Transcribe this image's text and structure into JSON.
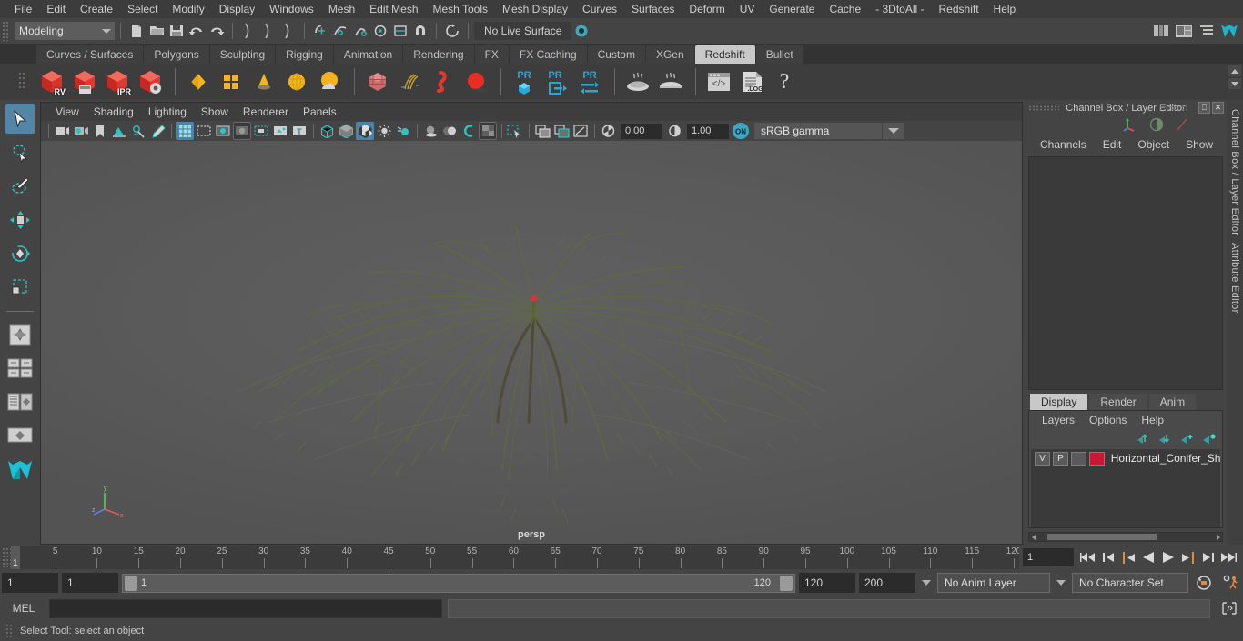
{
  "app": {
    "title": "Autodesk Maya",
    "accent": "#5285a6",
    "shelf_active_color": "#c8c8c8",
    "layer_color": "#c81832"
  },
  "menubar": {
    "items": [
      {
        "label": "File"
      },
      {
        "label": "Edit"
      },
      {
        "label": "Create"
      },
      {
        "label": "Select"
      },
      {
        "label": "Modify"
      },
      {
        "label": "Display"
      },
      {
        "label": "Windows"
      },
      {
        "label": "Mesh"
      },
      {
        "label": "Edit Mesh"
      },
      {
        "label": "Mesh Tools"
      },
      {
        "label": "Mesh Display"
      },
      {
        "label": "Curves"
      },
      {
        "label": "Surfaces"
      },
      {
        "label": "Deform"
      },
      {
        "label": "UV"
      },
      {
        "label": "Generate"
      },
      {
        "label": "Cache"
      },
      {
        "label": "- 3DtoAll -"
      },
      {
        "label": "Redshift"
      },
      {
        "label": "Help"
      }
    ]
  },
  "statusline": {
    "mode": "Modeling",
    "live_surface": "No Live Surface",
    "icons": [
      "new-scene-icon",
      "open-scene-icon",
      "save-scene-icon",
      "undo-icon",
      "redo-icon",
      "select-by-hierarchy-icon",
      "select-by-object-icon",
      "select-by-component-icon",
      "snap-grid-icon",
      "snap-curve-icon",
      "snap-point-icon",
      "snap-projected-icon",
      "snap-view-plane-icon",
      "construction-history-icon",
      "render-view-icon",
      "render-sequence-icon",
      "ipr-render-icon",
      "render-settings-icon",
      "hypershade-icon",
      "lightfog-icon",
      "outliner-icon",
      "node-editor-icon"
    ]
  },
  "shelf": {
    "tabs": [
      {
        "label": "Curves / Surfaces",
        "active": false
      },
      {
        "label": "Polygons",
        "active": false
      },
      {
        "label": "Sculpting",
        "active": false
      },
      {
        "label": "Rigging",
        "active": false
      },
      {
        "label": "Animation",
        "active": false
      },
      {
        "label": "Rendering",
        "active": false
      },
      {
        "label": "FX",
        "active": false
      },
      {
        "label": "FX Caching",
        "active": false
      },
      {
        "label": "Custom",
        "active": false
      },
      {
        "label": "XGen",
        "active": false
      },
      {
        "label": "Redshift",
        "active": true
      },
      {
        "label": "Bullet",
        "active": false
      }
    ],
    "buttons": [
      {
        "name": "redshift-render-view-icon",
        "label": "RV"
      },
      {
        "name": "redshift-render-sequence-icon",
        "label": ""
      },
      {
        "name": "redshift-ipr-icon",
        "label": "IPR"
      },
      {
        "name": "redshift-render-settings-icon",
        "label": ""
      },
      {
        "name": "redshift-area-light-icon",
        "label": ""
      },
      {
        "name": "redshift-portal-light-icon",
        "label": ""
      },
      {
        "name": "redshift-ies-light-icon",
        "label": ""
      },
      {
        "name": "redshift-dome-light-icon",
        "label": ""
      },
      {
        "name": "redshift-physical-sun-icon",
        "label": ""
      },
      {
        "name": "redshift-proxy-icon",
        "label": ""
      },
      {
        "name": "redshift-hair-icon",
        "label": ""
      },
      {
        "name": "redshift-volume-icon",
        "label": ""
      },
      {
        "name": "redshift-sphere-icon",
        "label": ""
      },
      {
        "name": "redshift-pr-object-icon",
        "label": "PR"
      },
      {
        "name": "redshift-pr-export-icon",
        "label": "PR"
      },
      {
        "name": "redshift-pr-transfer-icon",
        "label": "PR"
      },
      {
        "name": "redshift-bake-icon",
        "label": ""
      },
      {
        "name": "redshift-bake-set-icon",
        "label": ""
      },
      {
        "name": "redshift-script-editor-icon",
        "label": ""
      },
      {
        "name": "redshift-log-icon",
        "label": ".LOG"
      },
      {
        "name": "redshift-help-icon",
        "label": "?"
      }
    ]
  },
  "toolbox": {
    "items": [
      {
        "name": "select-tool",
        "selected": true
      },
      {
        "name": "lasso-select-tool",
        "selected": false
      },
      {
        "name": "paint-select-tool",
        "selected": false
      },
      {
        "name": "move-tool",
        "selected": false
      },
      {
        "name": "rotate-tool",
        "selected": false
      },
      {
        "name": "scale-tool",
        "selected": false
      },
      {
        "name": "last-tool-used",
        "selected": false
      },
      {
        "name": "four-view-layout",
        "selected": false
      },
      {
        "name": "persp-outliner-layout",
        "selected": false
      },
      {
        "name": "outliner-persp-layout",
        "selected": false
      },
      {
        "name": "single-persp-layout",
        "selected": false
      },
      {
        "name": "maya-logo",
        "selected": false
      }
    ]
  },
  "viewport": {
    "menus": [
      {
        "label": "View"
      },
      {
        "label": "Shading"
      },
      {
        "label": "Lighting"
      },
      {
        "label": "Show"
      },
      {
        "label": "Renderer"
      },
      {
        "label": "Panels"
      }
    ],
    "toolbar": {
      "exposure": "0.00",
      "gamma": "1.00",
      "color_management_toggle": "ON",
      "color_profile": "sRGB gamma",
      "icons": [
        "select-camera-icon",
        "camera-attributes-icon",
        "bookmark-icon",
        "image-plane-icon",
        "2d-pan-zoom-icon",
        "grease-pencil-icon",
        "grid-toggle-icon",
        "film-gate-icon",
        "resolution-gate-icon",
        "gate-mask-icon",
        "film-origin-icon",
        "safe-action-icon",
        "safe-title-icon",
        "wireframe-icon",
        "smooth-shade-all-icon",
        "smooth-shade-selected-icon",
        "flat-shade-icon",
        "wireframe-on-shaded-icon",
        "xray-icon",
        "xray-joints-icon",
        "default-lighting-icon",
        "all-lights-icon",
        "shadows-icon",
        "screen-space-ao-icon",
        "motion-blur-icon",
        "multisample-icon",
        "isolate-select-icon",
        "render-icon",
        "ipr-icon",
        "render-settings-icon"
      ]
    },
    "camera_label": "persp",
    "axis": {
      "x": "x",
      "y": "y",
      "z": "z"
    }
  },
  "channelbox": {
    "title": "Channel Box / Layer Editor",
    "window_buttons": [
      "restore-icon",
      "close-icon"
    ],
    "header_icons": [
      "transform-axis-icon",
      "contrast-icon",
      "slash-icon"
    ],
    "menus": [
      {
        "label": "Channels"
      },
      {
        "label": "Edit"
      },
      {
        "label": "Object"
      },
      {
        "label": "Show"
      }
    ],
    "dock_labels": [
      "Channel Box / Layer Editor",
      "Attribute Editor"
    ]
  },
  "layereditor": {
    "tabs": [
      {
        "label": "Display",
        "active": true
      },
      {
        "label": "Render",
        "active": false
      },
      {
        "label": "Anim",
        "active": false
      }
    ],
    "menus": [
      {
        "label": "Layers"
      },
      {
        "label": "Options"
      },
      {
        "label": "Help"
      }
    ],
    "buttons": [
      "move-layer-up-icon",
      "move-layer-down-icon",
      "new-layer-icon",
      "new-layer-from-selected-icon"
    ],
    "rows": [
      {
        "visibility": "V",
        "playback": "P",
        "shading": "",
        "color": "#c81832",
        "name": "Horizontal_Conifer_Sh"
      }
    ]
  },
  "timeslider": {
    "start": 1,
    "end": 120,
    "current_frame": "1",
    "frame_field": "1",
    "tick_labels": [
      5,
      10,
      15,
      20,
      25,
      30,
      35,
      40,
      45,
      50,
      55,
      60,
      65,
      70,
      75,
      80,
      85,
      90,
      95,
      100,
      105,
      110,
      115,
      120
    ],
    "transport_buttons": [
      "go-to-start-icon",
      "step-back-keyframe-icon",
      "step-back-frame-icon",
      "play-backwards-icon",
      "play-forwards-icon",
      "step-forward-frame-icon",
      "step-forward-keyframe-icon",
      "go-to-end-icon"
    ]
  },
  "rangeslider": {
    "anim_start": "1",
    "range_start": "1",
    "bar_start": "1",
    "bar_end": "120",
    "range_end": "120",
    "anim_end": "200",
    "anim_layer": "No Anim Layer",
    "character_set": "No Character Set",
    "icons": [
      "auto-keyframe-icon",
      "animation-preferences-icon"
    ]
  },
  "commandline": {
    "language": "MEL",
    "input_value": "",
    "output_value": "",
    "script_editor_icon": "script-editor-icon"
  },
  "helpline": {
    "text": "Select Tool: select an object"
  }
}
